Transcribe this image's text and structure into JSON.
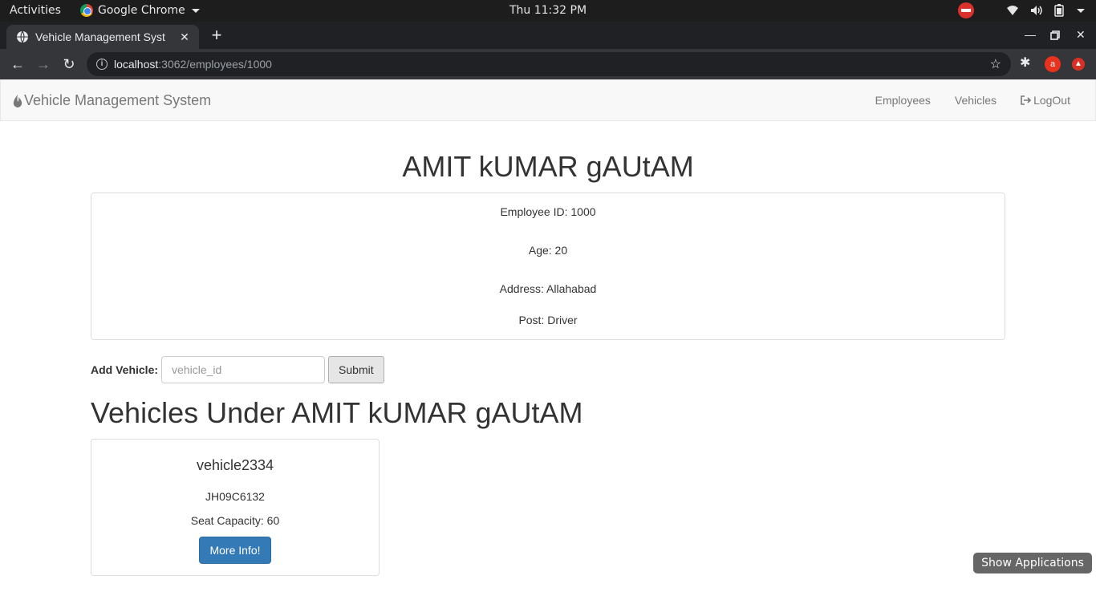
{
  "system_bar": {
    "activities": "Activities",
    "app_name": "Google Chrome",
    "clock": "Thu 11:32 PM"
  },
  "browser": {
    "tab_title": "Vehicle Management Syst",
    "url_host": "localhost",
    "url_rest": ":3062/employees/1000",
    "extension_avatar": "a"
  },
  "navbar": {
    "brand": "Vehicle Management System",
    "links": {
      "employees": "Employees",
      "vehicles": "Vehicles",
      "logout": "LogOut"
    }
  },
  "employee": {
    "name": "AMIT kUMAR gAUtAM",
    "id_line": "Employee ID: 1000",
    "age_line": "Age: 20",
    "address_line": "Address: Allahabad",
    "post_line": "Post: Driver"
  },
  "add_vehicle": {
    "label": "Add Vehicle:",
    "placeholder": "vehicle_id",
    "submit": "Submit"
  },
  "vehicles_section": {
    "heading": "Vehicles Under AMIT kUMAR gAUtAM",
    "cards": [
      {
        "name": "vehicle2334",
        "plate": "JH09C6132",
        "seat_line": "Seat Capacity: 60",
        "button": "More Info!"
      }
    ]
  },
  "overlay": {
    "show_applications": "Show Applications"
  },
  "colors": {
    "primary_button": "#337ab7",
    "navbar_bg": "#f8f8f8",
    "chrome_dark": "#202124"
  }
}
